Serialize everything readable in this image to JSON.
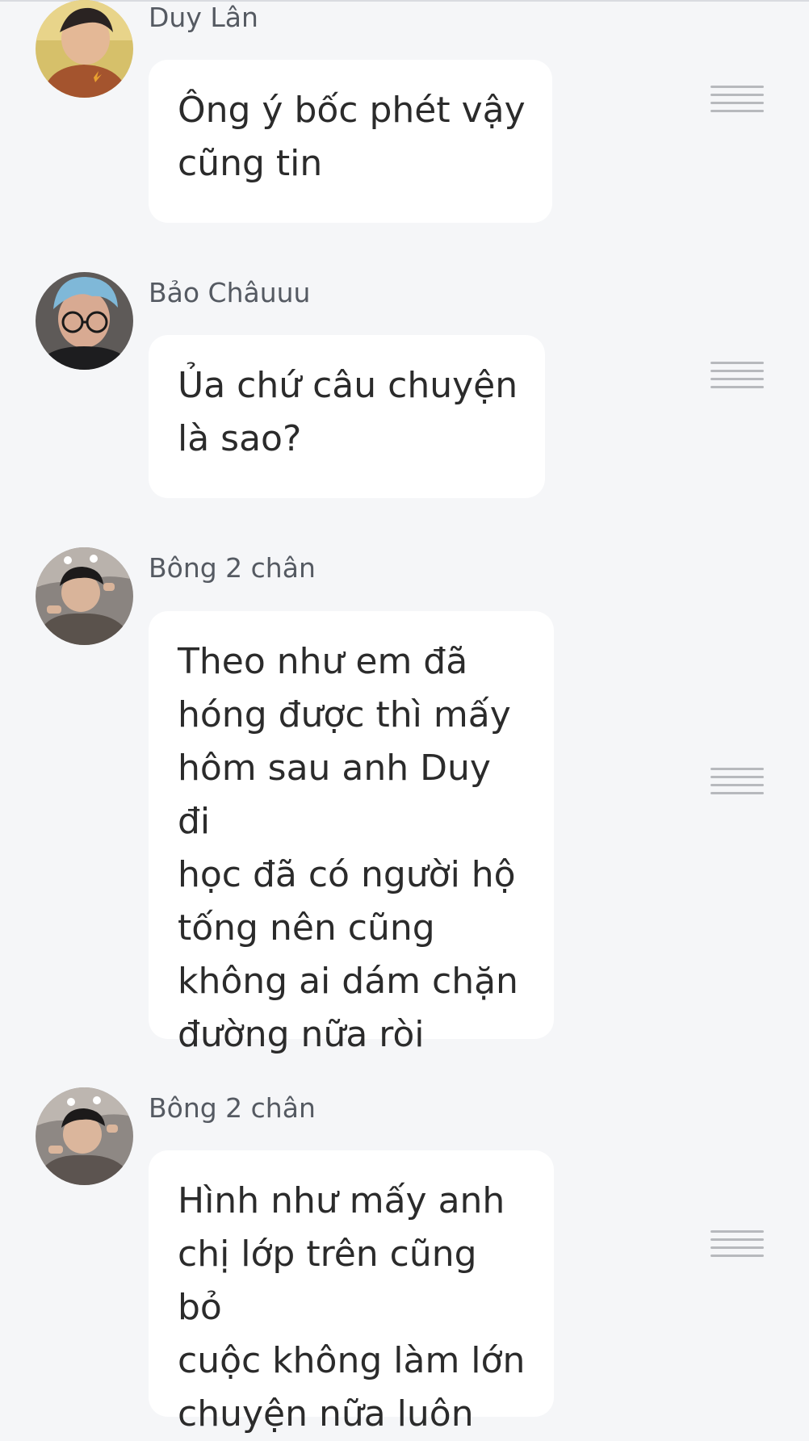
{
  "messages": [
    {
      "sender": "Duy Lân",
      "text": "Ông ý bốc phét vậy\ncũng tin",
      "avatar_icon": "profile-photo-icon",
      "menu_icon": "hamburger-menu-icon"
    },
    {
      "sender": "Bảo Châuuu",
      "text": "Ủa chứ câu chuyện\nlà sao?",
      "avatar_icon": "profile-photo-icon",
      "menu_icon": "hamburger-menu-icon"
    },
    {
      "sender": "Bông 2 chân",
      "text": "Theo như em đã\nhóng được thì mấy\nhôm sau anh Duy đi\nhọc đã có người hộ\ntống nên cũng\nkhông ai dám chặn\nđường nữa ròi",
      "avatar_icon": "profile-photo-icon",
      "menu_icon": "hamburger-menu-icon"
    },
    {
      "sender": "Bông 2 chân",
      "text": "Hình như mấy anh\nchị lớp trên cũng bỏ\ncuộc không làm lớn\nchuyện nữa luôn",
      "avatar_icon": "profile-photo-icon",
      "menu_icon": "hamburger-menu-icon"
    }
  ],
  "colors": {
    "background": "#f5f6f8",
    "bubble": "#ffffff",
    "text": "#2b2b2b",
    "sender": "#555a62",
    "menu_icon": "#b7b9bd"
  }
}
